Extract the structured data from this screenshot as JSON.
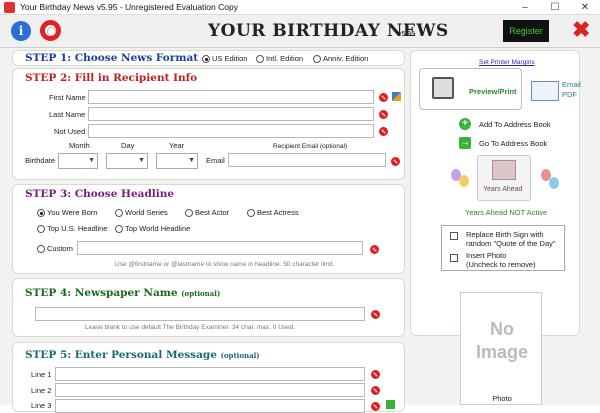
{
  "window": {
    "title": "Your Birthday News v5.95 - Unregistered Evaluation Copy",
    "minimize": "–",
    "maximize": "☐",
    "close": "✕"
  },
  "header": {
    "logo": "YOUR BIRTHDAY NEWS",
    "version": "v5.95",
    "register_label": "Register",
    "info_glyph": "i",
    "close_glyph": "✖"
  },
  "step1": {
    "title": "STEP 1: Choose News Format",
    "options": [
      "US Edition",
      "Intl. Edition",
      "Anniv. Edition"
    ],
    "selected": "US Edition"
  },
  "step2": {
    "title": "STEP 2: Fill in Recipient Info",
    "first_name": "First Name",
    "last_name": "Last Name",
    "not_used": "Not Used",
    "month": "Month",
    "day": "Day",
    "year": "Year",
    "birthdate": "Birthdate",
    "recipient_email_hint": "Recipient Email (optional)",
    "email": "Email"
  },
  "step3": {
    "title": "STEP 3: Choose Headline",
    "options": [
      "You Were Born",
      "World Series",
      "Best Actor",
      "Best Actress",
      "Top U.S. Headline",
      "Top World Headline",
      "Custom"
    ],
    "selected": "You Were Born",
    "hint": "Use @firstname or @lastname to show name in headline. 50 character limit."
  },
  "step4": {
    "title": "STEP 4: Newspaper Name",
    "optional": "(optional)",
    "hint": "Leave blank to use default The Birthday Examiner. 34 char. max. 0 Used."
  },
  "step5": {
    "title": "STEP 5: Enter Personal Message",
    "optional": "(optional)",
    "lines": [
      "Line 1",
      "Line 2",
      "Line 3"
    ]
  },
  "right": {
    "printer_margins": "Set Printer Margins",
    "preview_print": "Preview/Print",
    "email_pdf_1": "Email",
    "email_pdf_2": "PDF",
    "add_address": "Add To Address Book",
    "go_address": "Go To Address Book",
    "years_ahead": "Years Ahead",
    "years_ahead_status": "Years Ahead NOT Active",
    "replace_sign_1": "Replace Birth Sign with",
    "replace_sign_2": "random \"Quote of the Day\"",
    "insert_photo_1": "Insert Photo",
    "insert_photo_2": "(Uncheck to remove)",
    "no_image_1": "No",
    "no_image_2": "Image",
    "photo": "Photo"
  },
  "colors": {
    "step_blue": "#1a3e9a",
    "step_red": "#c02020",
    "step_purple": "#7a1a7a",
    "step_green": "#1a6a1a",
    "step_teal": "#1a6a6a",
    "years_green": "#2a8a2a"
  }
}
